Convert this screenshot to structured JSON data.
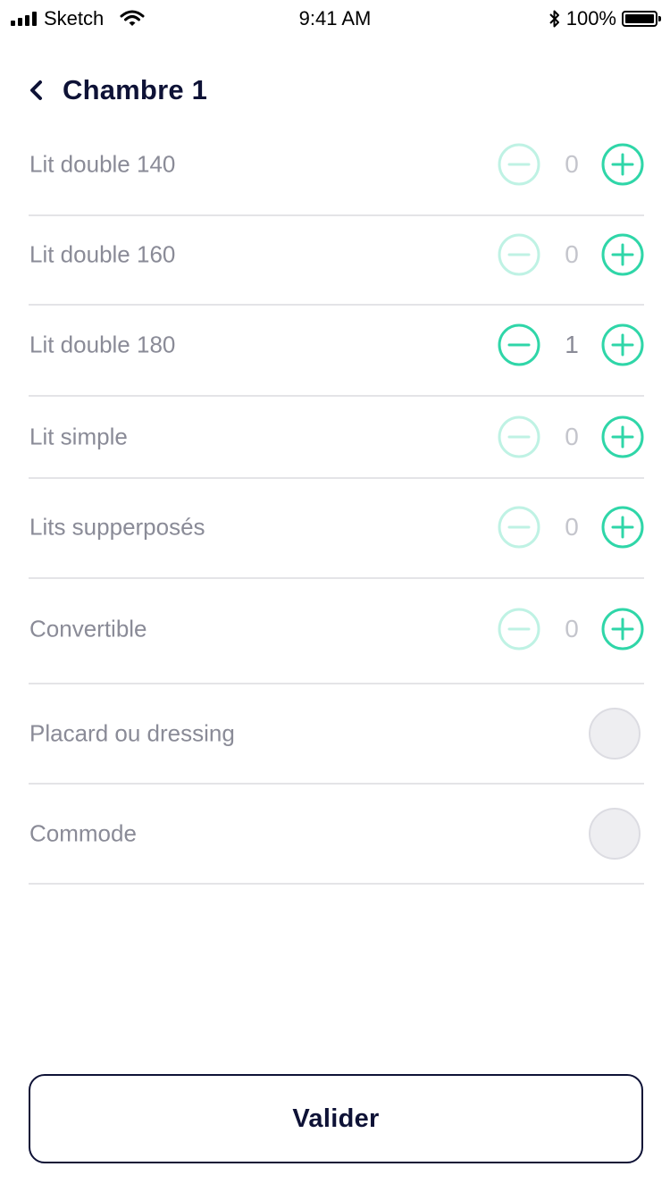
{
  "status_bar": {
    "carrier": "Sketch",
    "time": "9:41 AM",
    "battery": "100%",
    "battery_level": 1.0
  },
  "header": {
    "back_icon": "chevron-left-icon",
    "title": "Chambre 1"
  },
  "accent_color": "#2fd6a8",
  "items": [
    {
      "label": "Lit double 140",
      "type": "stepper",
      "value": "0"
    },
    {
      "label": "Lit double 160",
      "type": "stepper",
      "value": "0"
    },
    {
      "label": "Lit double 180",
      "type": "stepper",
      "value": "1"
    },
    {
      "label": "Lit simple",
      "type": "stepper",
      "value": "0"
    },
    {
      "label": "Lits supperposés",
      "type": "stepper",
      "value": "0"
    },
    {
      "label": "Convertible",
      "type": "stepper",
      "value": "0"
    },
    {
      "label": "Placard ou dressing",
      "type": "toggle",
      "checked": false
    },
    {
      "label": "Commode",
      "type": "toggle",
      "checked": false
    }
  ],
  "validate_button": {
    "label": "Valider"
  }
}
